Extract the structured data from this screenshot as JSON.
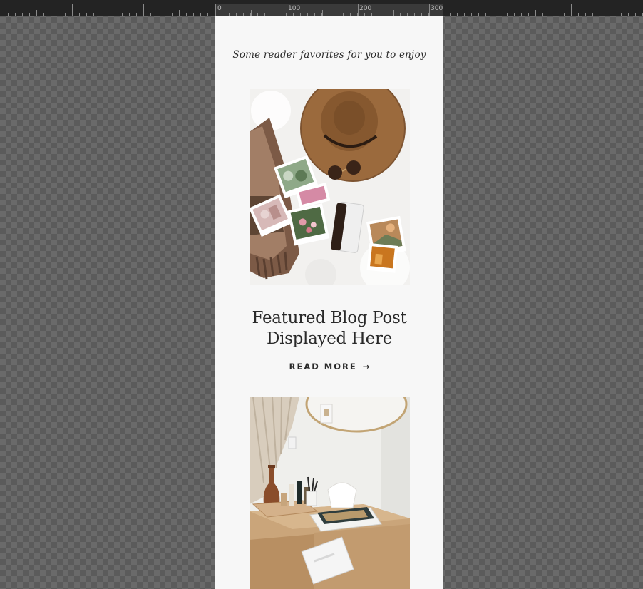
{
  "ruler": {
    "labels": [
      "0",
      "100",
      "200",
      "300"
    ]
  },
  "page": {
    "tagline": "Some reader favorites for you to enjoy",
    "posts": [
      {
        "image": "flatlay-hat-photos-image",
        "title_line1": "Featured Blog Post",
        "title_line2": "Displayed Here",
        "read_more": "READ MORE",
        "arrow": "→"
      },
      {
        "image": "vanity-dresser-image"
      }
    ]
  },
  "colors": {
    "artboard": "#f7f7f7",
    "text": "#2a2a2a",
    "canvas_checker": "#5b5b5b"
  }
}
